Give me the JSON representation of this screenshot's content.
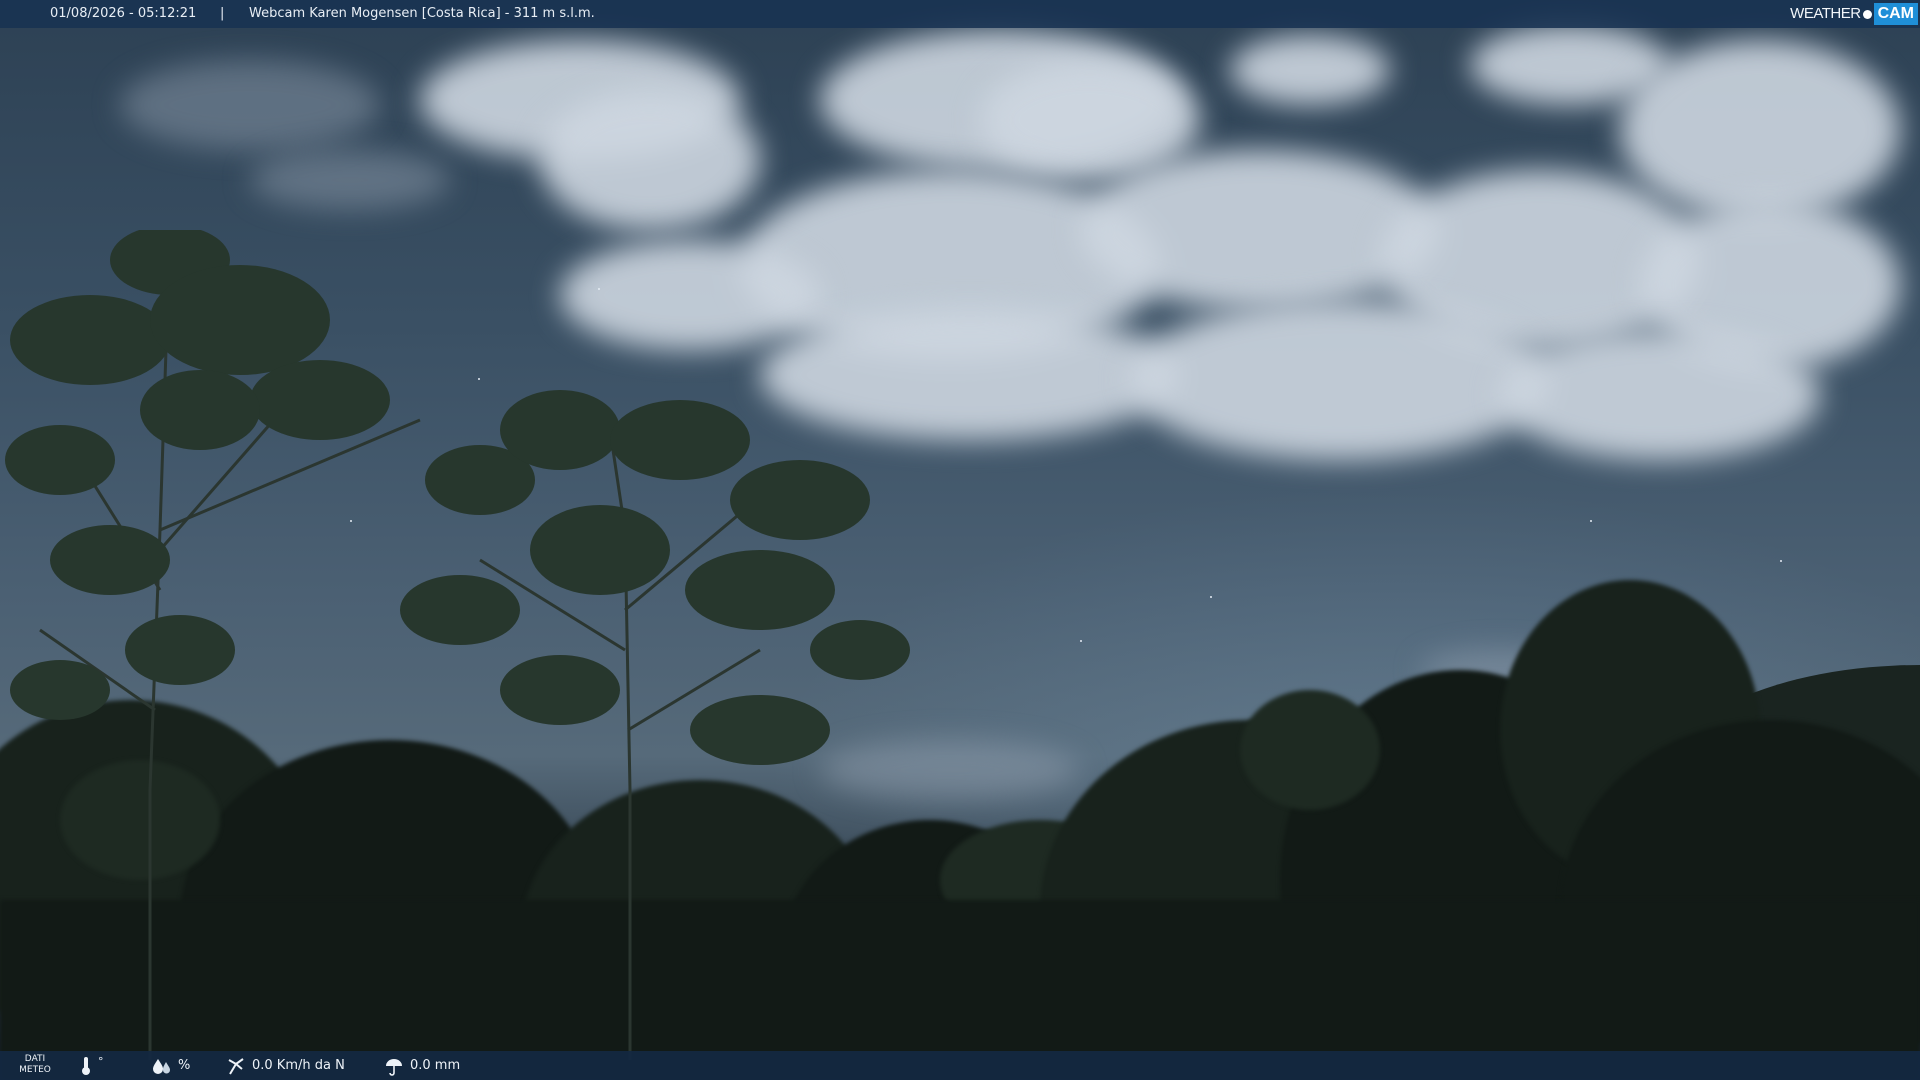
{
  "header": {
    "datetime": "01/08/2026 - 05:12:21",
    "separator": "|",
    "camera_title": "Webcam Karen Mogensen [Costa Rica] - 311 m s.l.m.",
    "logo": {
      "weather": "WEATHER",
      "cam": "CAM",
      "accent_color": "#1f8fd8"
    }
  },
  "footer": {
    "dati_meteo_label_line1": "DATI",
    "dati_meteo_label_line2": "METEO",
    "temperature": {
      "icon": "thermometer-icon",
      "value": "°"
    },
    "humidity": {
      "icon": "humidity-icon",
      "value": "%"
    },
    "wind": {
      "icon": "wind-icon",
      "value": "0.0 Km/h da N"
    },
    "rain": {
      "icon": "rain-icon",
      "value": "0.0 mm"
    }
  },
  "colors": {
    "bar_background": "#183252",
    "text": "#e8eef5"
  }
}
